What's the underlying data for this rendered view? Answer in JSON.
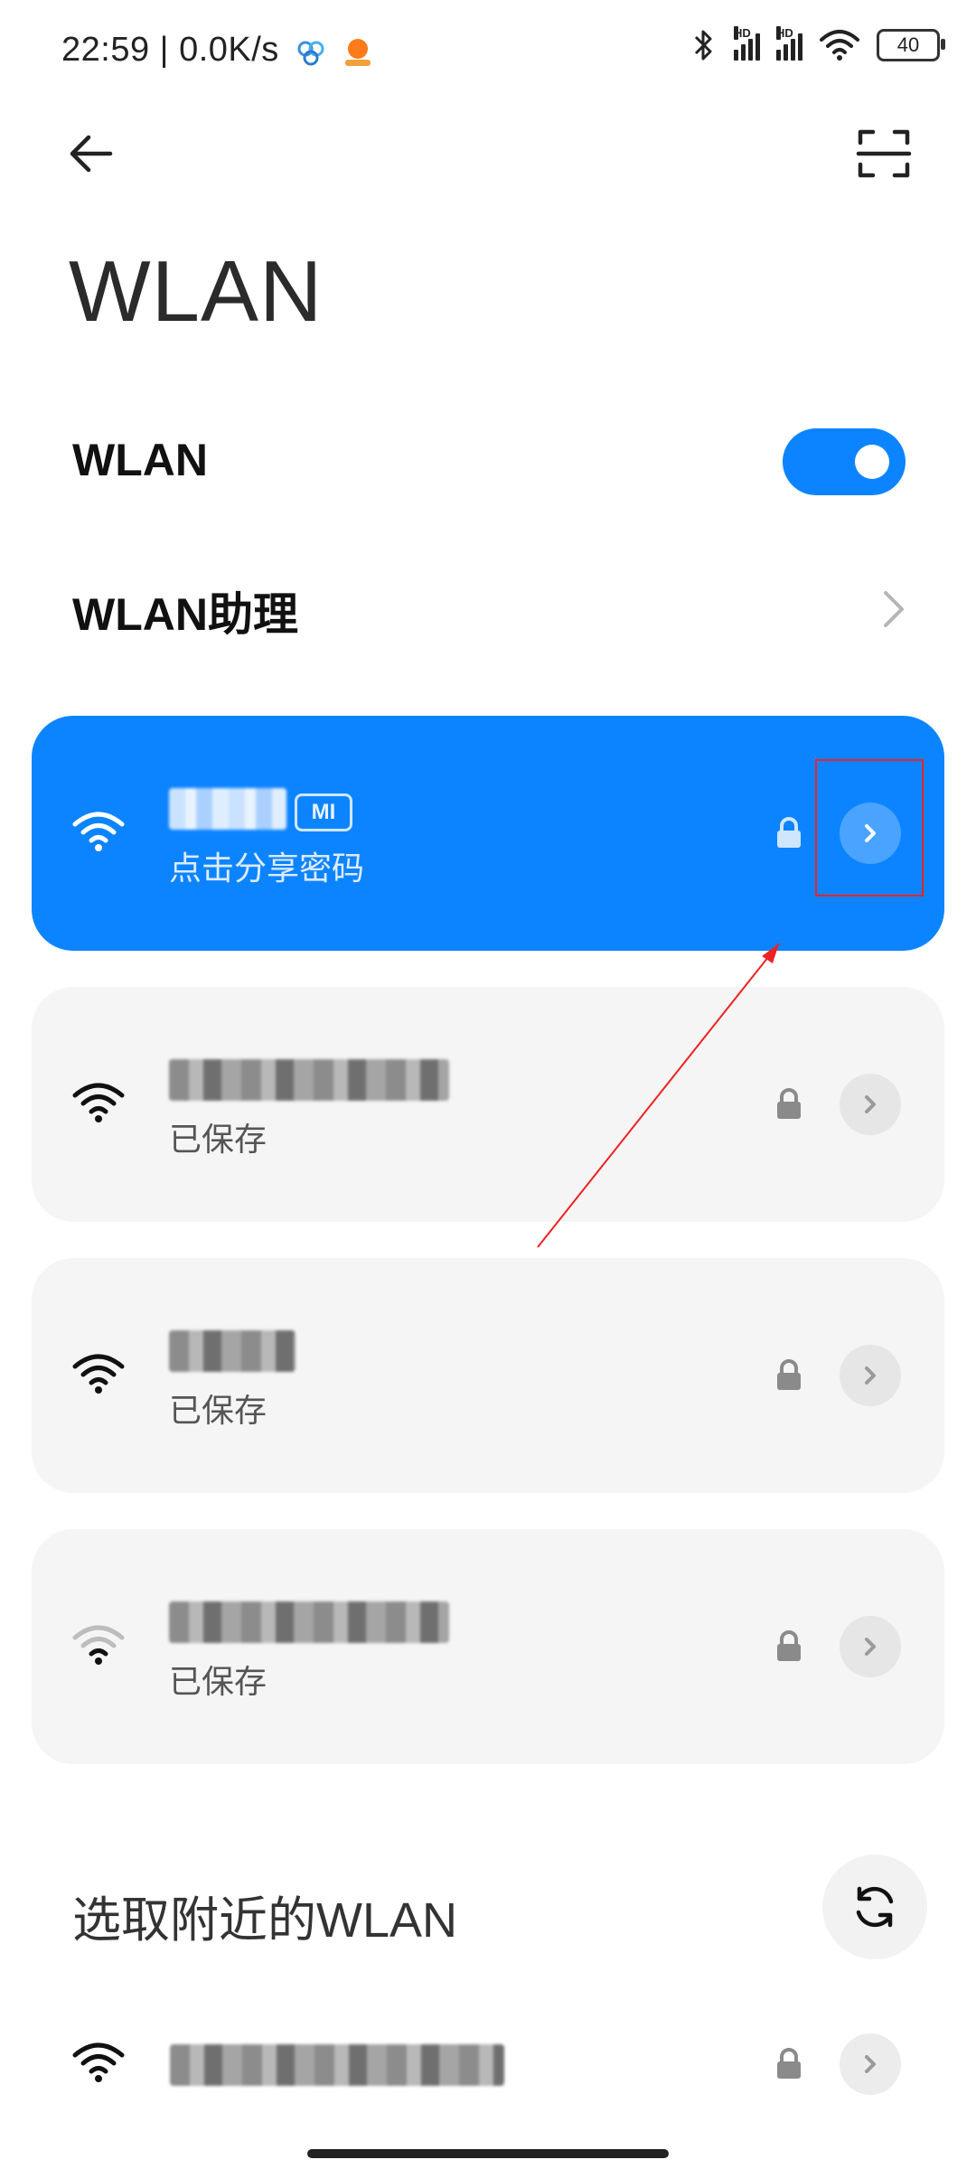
{
  "status_bar": {
    "time_speed": "22:59 | 0.0K/s",
    "battery": "40",
    "hd_label": "HD"
  },
  "header": {
    "title": "WLAN"
  },
  "settings": {
    "wlan_label": "WLAN",
    "wlan_enabled": true,
    "assistant_label": "WLAN助理"
  },
  "networks": [
    {
      "subtitle": "点击分享密码",
      "connected": true,
      "badge": "MI"
    },
    {
      "subtitle": "已保存",
      "connected": false
    },
    {
      "subtitle": "已保存",
      "connected": false
    },
    {
      "subtitle": "已保存",
      "connected": false
    }
  ],
  "nearby": {
    "title": "选取附近的WLAN"
  },
  "colors": {
    "accent": "#0d84ff",
    "card_bg": "#f5f5f5",
    "annotation": "#e22222"
  }
}
